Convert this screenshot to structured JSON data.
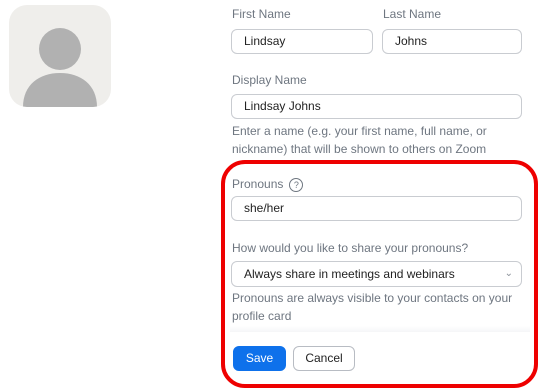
{
  "profile": {
    "avatar_icon": "user-silhouette-icon",
    "first_name": {
      "label": "First Name",
      "value": "Lindsay"
    },
    "last_name": {
      "label": "Last Name",
      "value": "Johns"
    },
    "display_name": {
      "label": "Display Name",
      "value": "Lindsay Johns",
      "help": "Enter a name (e.g. your first name, full name, or nickname) that will be shown to others on Zoom"
    }
  },
  "pronouns": {
    "label": "Pronouns",
    "help_icon": "question-circle-icon",
    "value": "she/her",
    "share_label": "How would you like to share your pronouns?",
    "share_value": "Always share in meetings and webinars",
    "share_help": "Pronouns are always visible to your contacts on your profile card"
  },
  "actions": {
    "save": "Save",
    "cancel": "Cancel"
  },
  "colors": {
    "primary": "#0e71eb",
    "highlight": "#ee0000"
  }
}
